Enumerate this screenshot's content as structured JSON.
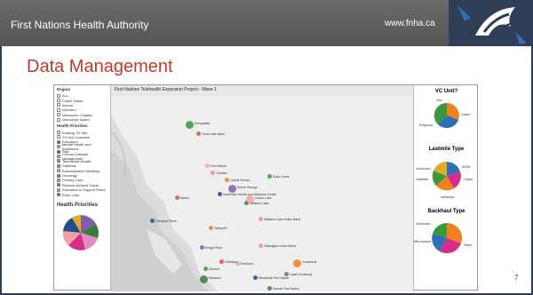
{
  "header": {
    "org": "First Nations Health Authority",
    "url": "www.fnha.ca"
  },
  "slide": {
    "title": "Data Management",
    "number": "7"
  },
  "dashboard": {
    "map_title": "First Nations Telehealth Expansion Project - Wave 1",
    "region_label": "Region",
    "regions": [
      "ALL",
      "Fraser Salish",
      "Interior",
      "Northern",
      "Vancouver Coastal",
      "Vancouver Island"
    ],
    "priorities_label": "Health Priorities",
    "priorities": [
      {
        "label": "Existing TH Site",
        "color": "#f4d8d8"
      },
      {
        "label": "TH Not Complete",
        "color": "#f3f3f3"
      },
      {
        "label": "Education",
        "color": "#3a7d3a"
      },
      {
        "label": "Mental Health and Addictions",
        "color": "#7fbf7f"
      },
      {
        "label": "Rad",
        "color": "#1f4e8c"
      },
      {
        "label": "Chronic Disease Management",
        "color": "#e0ac27"
      },
      {
        "label": "Telemental Health",
        "color": "#a68c2a"
      },
      {
        "label": "Diabetes",
        "color": "#d9534f"
      },
      {
        "label": "Administrative Meetings",
        "color": "#f5a0a0"
      },
      {
        "label": "Oncology",
        "color": "#7f5fa8"
      },
      {
        "label": "Primary Care",
        "color": "#b08fd0"
      },
      {
        "label": "Restore Medical Travel",
        "color": "#8a5a3a"
      },
      {
        "label": "Education in Support Roles",
        "color": "#e38ac2"
      },
      {
        "label": "Elder Care",
        "color": "#d62d8a"
      }
    ],
    "health_priorities_title": "Health Priorities",
    "vc_title": "VC Unit?",
    "lastmile_title": "Lastmile Type",
    "backhaul_title": "Backhaul Type",
    "vc_labels": [
      "Yes",
      "Video",
      "Polycom"
    ],
    "lastmile_labels": [
      "Unknown",
      "ADSL",
      "Satellite",
      "Cable",
      "Wireless"
    ],
    "backhaul_labels": [
      "Unknown",
      "Microwave",
      "Fibre"
    ],
    "cities": [
      "Kinoquitkia",
      "Trout Lake Band",
      "Fort Nelson",
      "Tumbler",
      "Lheidli Tenneh",
      "Prince George",
      "Southside Health and Wellness Centre",
      "Williams Lake",
      "Soda Creek",
      "Nazko",
      "Canim Lake",
      "Williams Lake Indian Band",
      "Tsilhqot'in",
      "Bridge River",
      "Campbell River",
      "Nanaimo",
      "Sechelt",
      "Chilliwack",
      "Penticton",
      "Okanagan Indian Band",
      "Cranbrook",
      "Lower Kootenay",
      "Westbank First Nation",
      "Sumas First Nation"
    ],
    "colors": {
      "header": "#5e5e5e",
      "accent": "#c0392b",
      "frame": "#2f3e56"
    }
  }
}
